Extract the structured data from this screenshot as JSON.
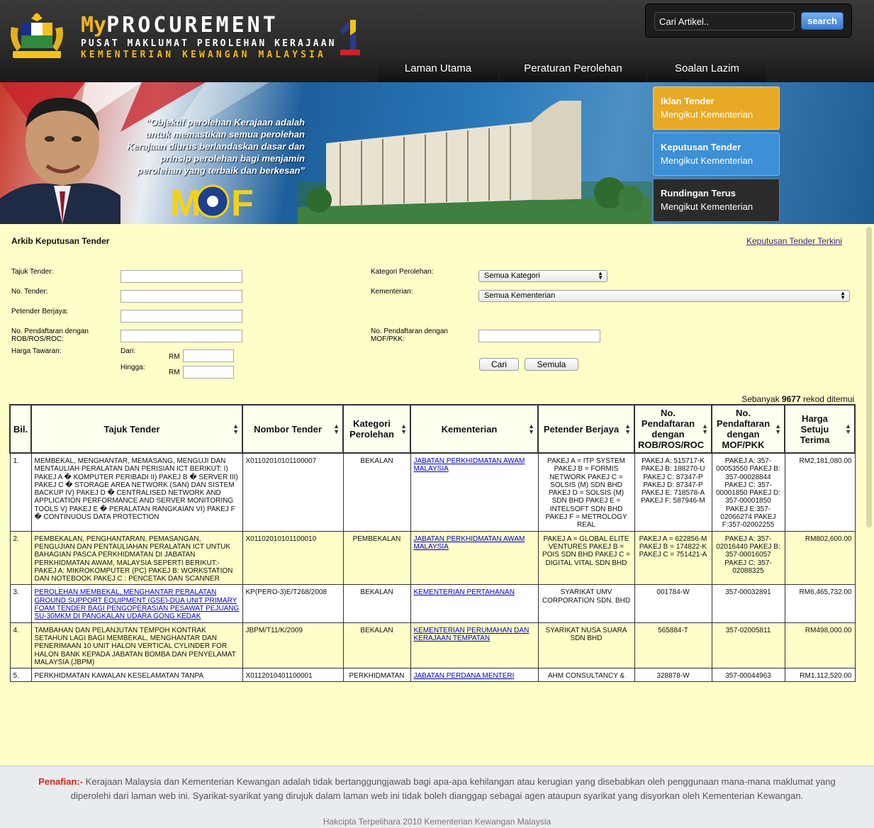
{
  "header": {
    "title_my": "My",
    "title_rest": "PROCUREMENT",
    "subtitle_1": "PUSAT MAKLUMAT PEROLEHAN KERAJAAN",
    "subtitle_2": "KEMENTERIAN KEWANGAN MALAYSIA",
    "search_placeholder": "Cari Artikel..",
    "search_button": "search"
  },
  "nav": {
    "tabs": [
      "Laman Utama",
      "Peraturan Perolehan",
      "Soalan Lazim"
    ]
  },
  "banner": {
    "quote": "“Objektif perolehan Kerajaan adalah untuk memastikan semua perolehan Kerajaan diurus berlandaskan dasar dan prinsip perolehan bagi menjamin perolehan yang terbaik dan berkesan”",
    "side_buttons": [
      {
        "line1": "Iklan Tender",
        "line2": "Mengikut Kementerian",
        "color": "#e8a926"
      },
      {
        "line1": "Keputusan Tender",
        "line2": "Mengikut Kementerian",
        "color": "#3d8fd6"
      },
      {
        "line1": "Rundingan Terus",
        "line2": "Mengikut Kementerian",
        "color": "#2b2b2b"
      }
    ]
  },
  "page": {
    "title": "Arkib Keputusan Tender",
    "latest_link": "Keputusan Tender Terkini"
  },
  "form": {
    "tajuk_label": "Tajuk Tender:",
    "no_tender_label": "No. Tender:",
    "petender_label": "Petender Berjaya:",
    "rob_label": "No. Pendaftaran dengan ROB/ROS/ROC:",
    "harga_label": "Harga Tawaran:",
    "dari_label": "Dari:",
    "hingga_label": "Hingga:",
    "rm_label": "RM",
    "kategori_label": "Kategori Perolehan:",
    "kategori_value": "Semua Kategori",
    "kementerian_label": "Kementerian:",
    "kementerian_value": "Semua Kementerian",
    "mof_label": "No. Pendaftaran dengan MOF/PKK:",
    "cari_button": "Cari",
    "semula_button": "Semula"
  },
  "results": {
    "count_prefix": "Sebanyak ",
    "count": "9677",
    "count_suffix": " rekod ditemui",
    "columns": [
      "Bil.",
      "Tajuk Tender",
      "Nombor Tender",
      "Kategori Perolehan",
      "Kementerian",
      "Petender Berjaya",
      "No. Pendaftaran dengan ROB/ROS/ROC",
      "No. Pendaftaran dengan MOF/PKK",
      "Harga Setuju Terima"
    ],
    "rows": [
      {
        "bil": "1.",
        "tajuk": "MEMBEKAL, MENGHANTAR, MEMASANG, MENGUJI DAN MENTAULIAH PERALATAN DAN PERISIAN ICT BERIKUT: I) PAKEJ A � KOMPUTER PERIBADI II) PAKEJ B � SERVER III) PAKEJ C � STORAGE AREA NETWORK (SAN) DAN SISTEM BACKUP IV) PAKEJ D � CENTRALISED NETWORK AND APPLICATION PERFORMANCE AND SERVER MONITORING TOOLS V) PAKEJ E � PERALATAN RANGKAIAN VI) PAKEJ F � CONTINUOUS DATA PROTECTION",
        "tajuk_link": false,
        "nombor": "X01102010101100007",
        "kategori": "BEKALAN",
        "kementerian": "JABATAN PERKHIDMATAN AWAM MALAYSIA",
        "petender": "PAKEJ A = ITP SYSTEM PAKEJ B = FORMIS NETWORK PAKEJ C = SOLSIS (M) SDN BHD PAKEJ D = SOLSIS (M) SDN BHD PAKEJ E = INTELSOFT SDN BHD PAKEJ F = METROLOGY REAL",
        "rob": "PAKEJ A: 515717-K PAKEJ B: 188270-U PAKEJ C: 87347-P PAKEJ D: 87347-P PAKEJ E: 718578-A PAKEJ F: 587946-M",
        "mof": "PAKEJ A: 357-00053550 PAKEJ B: 357-00028844 PAKEJ C: 357-00001850 PAKEJ D: 357-00001850 PAKEJ E:357-02066274 PAKEJ F:357-02002255",
        "harga": "RM2,181,080.00"
      },
      {
        "bil": "2.",
        "tajuk": "PEMBEKALAN, PENGHANTARAN, PEMASANGAN, PENGUJIAN DAN PENTAULIAHAN PERALATAN ICT UNTUK BAHAGIAN PASCA PERKHIDMATAN DI JABATAN PERKHIDMATAN AWAM, MALAYSIA SEPERTI BERIKUT:- PAKEJ A: MIKROKOMPUTER (PC) PAKEJ B: WORKSTATION DAN NOTEBOOK PAKEJ C : PENCETAK DAN SCANNER",
        "tajuk_link": false,
        "nombor": "X01102010101100010",
        "kategori": "PEMBEKALAN",
        "kementerian": "JABATAN PERKHIDMATAN AWAM MALAYSIA",
        "petender": "PAKEJ A = GLOBAL ELITE VENTURES PAKEJ B = POIS SDN BHD PAKEJ C = DIGITAL VITAL SDN BHD",
        "rob": "PAKEJ A = 622856-M PAKEJ B = 174822-K PAKEJ C = 751421-A",
        "mof": "PAKEJ A: 357-02016440 PAKEJ B: 357-00016057 PAKEJ C: 357-02088325",
        "harga": "RM802,600.00"
      },
      {
        "bil": "3.",
        "tajuk": "PEROLEHAN MEMBEKAL, MENGHANTAR PERALATAN GROUND SUPPORT EQUIPMENT (GSE)-DUA UNIT PRIMARY FOAM TENDER BAGI PENGOPERASIAN PESAWAT PEJUANG SU-30MKM DI PANGKALAN UDARA GONG KEDAK",
        "tajuk_link": true,
        "nombor": "KP(PERO-3)E/T268/2008",
        "kategori": "BEKALAN",
        "kementerian": "KEMENTERIAN PERTAHANAN",
        "petender": "SYARIKAT UMV CORPORATION SDN. BHD",
        "rob": "001784-W",
        "mof": "357-00032891",
        "harga": "RM6,465,732.00"
      },
      {
        "bil": "4.",
        "tajuk": "TAMBAHAN DAN PELANJUTAN TEMPOH KONTRAK SETAHUN LAGI BAGI MEMBEKAL, MENGHANTAR DAN PENERIMAAN 10 UNIT HALON VERTICAL CYLINDER FOR HALON BANK KEPADA JABATAN BOMBA DAN PENYELAMAT MALAYSIA (JBPM)",
        "tajuk_link": false,
        "nombor": "JBPM/T11/K/2009",
        "kategori": "BEKALAN",
        "kementerian": "KEMENTERIAN PERUMAHAN DAN KERAJAAN TEMPATAN",
        "petender": "SYARIKAT NUSA SUARA SDN BHD",
        "rob": "565884-T",
        "mof": "357-02005811",
        "harga": "RM498,000.00"
      },
      {
        "bil": "5.",
        "tajuk": "PERKHIDMATAN KAWALAN KESELAMATAN TANPA",
        "tajuk_link": false,
        "nombor": "X0112010401100001",
        "kategori": "PERKHIDMATAN",
        "kementerian": "JABATAN PERDANA MENTERI",
        "petender": "AHM CONSULTANCY &",
        "rob": "328878-W",
        "mof": "357-00044963",
        "harga": "RM1,112,520.00"
      }
    ]
  },
  "footer": {
    "disclaimer_label": "Penafian:-",
    "disclaimer_text": " Kerajaan Malaysia dan Kementerian Kewangan adalah tidak bertanggungjawab bagi apa-apa kehilangan atau kerugian yang disebabkan oleh penggunaan mana-mana maklumat yang diperolehi dari laman web ini. Syarikat-syarikat yang dirujuk dalam laman web ini tidak boleh dianggap sebagai agen ataupun syarikat yang disyorkan oleh Kementerian Kewangan.",
    "copyright": "Hakcipta Terpelihara 2010 Kementerian Kewangan Malaysia"
  }
}
